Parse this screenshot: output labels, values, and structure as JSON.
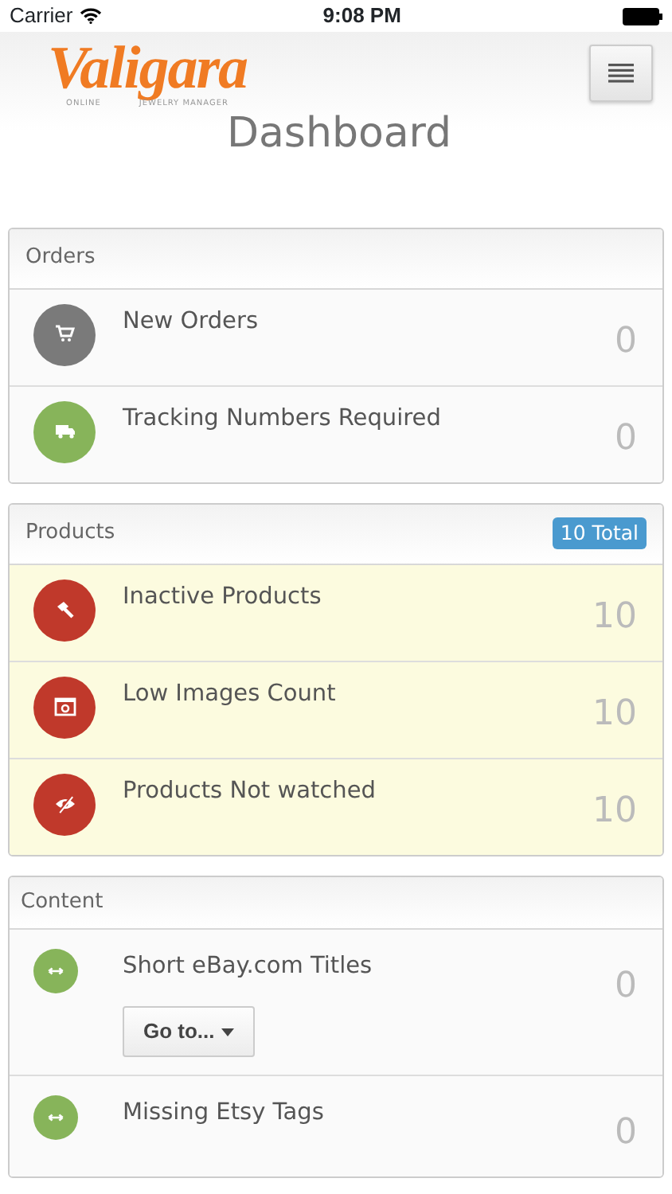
{
  "status_bar": {
    "carrier": "Carrier",
    "time": "9:08 PM"
  },
  "header": {
    "logo": "Valigara",
    "logo_tagline_left": "ONLINE",
    "logo_tagline_right": "JEWELRY MANAGER",
    "page_title": "Dashboard"
  },
  "panels": [
    {
      "title": "Orders",
      "rows": [
        {
          "kind": "cart",
          "color": "#7a7a7a",
          "label": "New Orders",
          "count": "0",
          "highlighted": false
        },
        {
          "kind": "truck",
          "color": "#87b45a",
          "label": "Tracking Numbers Required",
          "count": "0",
          "highlighted": false
        }
      ]
    },
    {
      "title": "Products",
      "badge": "10 Total",
      "rows": [
        {
          "kind": "hammer",
          "color": "#c0392b",
          "label": "Inactive Products",
          "count": "10",
          "highlighted": true
        },
        {
          "kind": "image",
          "color": "#c0392b",
          "label": "Low Images Count",
          "count": "10",
          "highlighted": true
        },
        {
          "kind": "eye-slash",
          "color": "#c0392b",
          "label": "Products Not watched",
          "count": "10",
          "highlighted": true
        }
      ]
    },
    {
      "title": "Content",
      "compact": true,
      "rows": [
        {
          "kind": "arrows",
          "color": "#87b45a",
          "label": "Short eBay.com Titles",
          "count": "0",
          "highlighted": false,
          "button": "Go to..."
        },
        {
          "kind": "arrows",
          "color": "#87b45a",
          "label": "Missing Etsy Tags",
          "count": "0",
          "highlighted": false
        }
      ]
    }
  ]
}
